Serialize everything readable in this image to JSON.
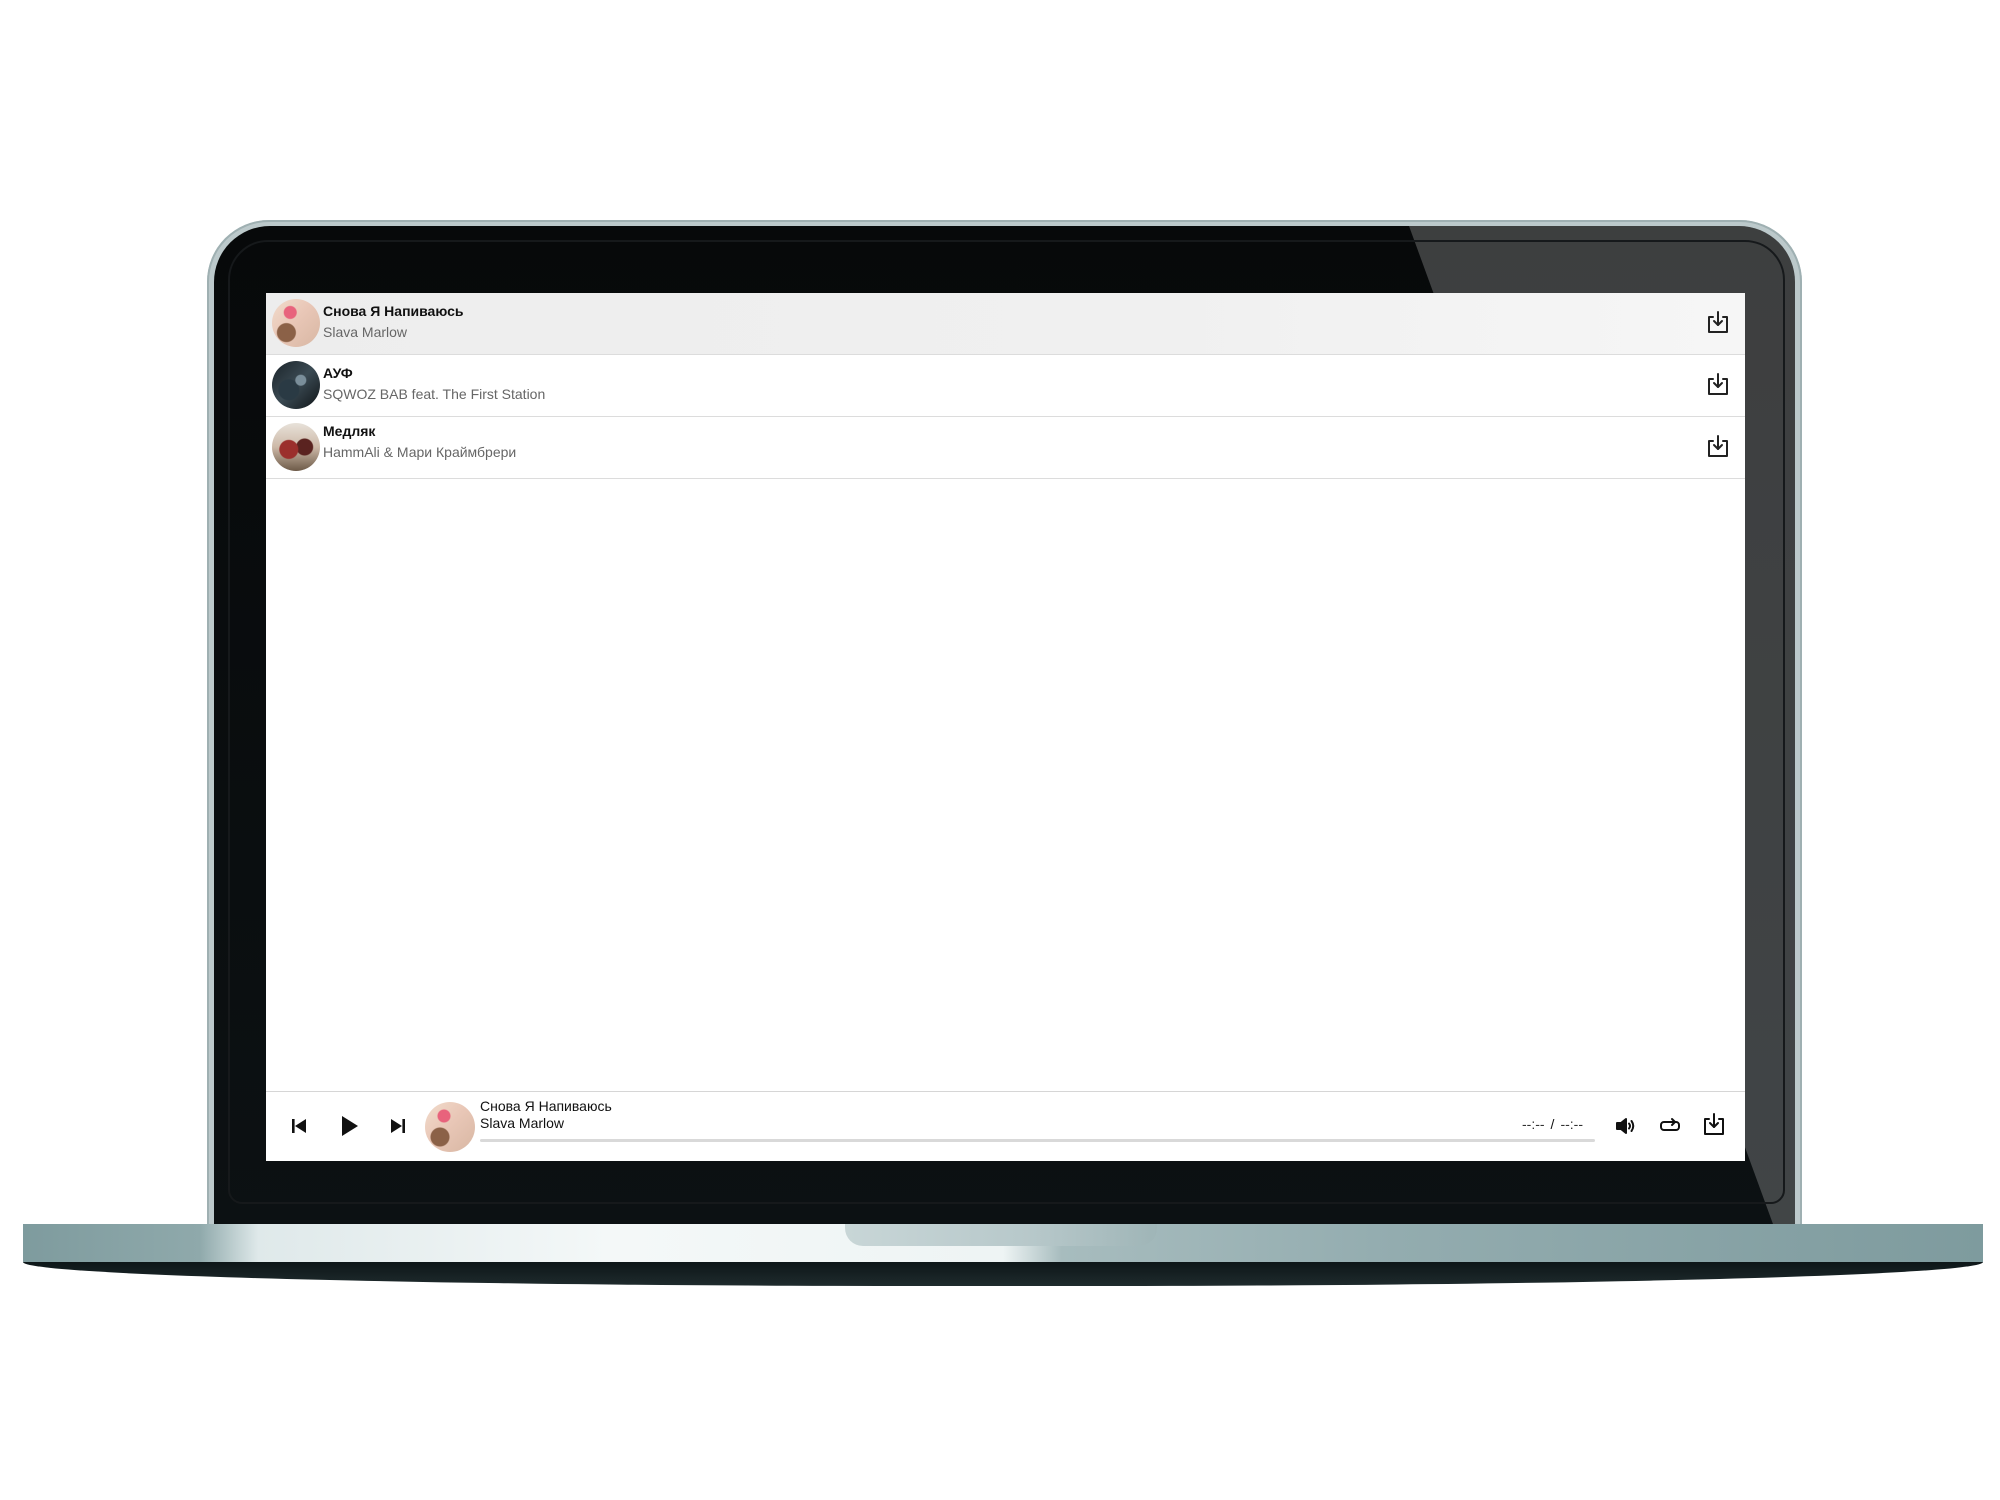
{
  "tracks": [
    {
      "title": "Снова Я Напиваюсь",
      "artist": "Slava Marlow",
      "active": true,
      "cover_icon": "album-cover-slava-marlow"
    },
    {
      "title": "АУФ",
      "artist": "SQWOZ BAB feat. The First Station",
      "active": false,
      "cover_icon": "album-cover-sqwoz-bab"
    },
    {
      "title": "Медляк",
      "artist": "HammAli & Мари Краймбрери",
      "active": false,
      "cover_icon": "album-cover-hammali"
    }
  ],
  "player": {
    "now_playing": {
      "title": "Снова Я Напиваюсь",
      "artist": "Slava Marlow"
    },
    "current_time": "--:--",
    "separator": "/",
    "duration": "--:--",
    "progress": 0,
    "icons": [
      "previous-icon",
      "play-icon",
      "next-icon",
      "volume-icon",
      "repeat-icon",
      "download-icon"
    ]
  },
  "colors": {
    "active_row": "#efefef",
    "divider": "#dcdcdc",
    "text_primary": "#111111",
    "text_secondary": "#666666"
  }
}
